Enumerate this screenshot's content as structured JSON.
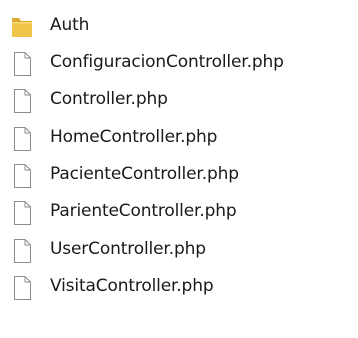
{
  "folder": {
    "items": [
      {
        "name": "Auth",
        "type": "folder",
        "icon": "folder-icon"
      },
      {
        "name": "ConfiguracionController.php",
        "type": "file",
        "icon": "file-icon"
      },
      {
        "name": "Controller.php",
        "type": "file",
        "icon": "file-icon"
      },
      {
        "name": "HomeController.php",
        "type": "file",
        "icon": "file-icon"
      },
      {
        "name": "PacienteController.php",
        "type": "file",
        "icon": "file-icon"
      },
      {
        "name": "ParienteController.php",
        "type": "file",
        "icon": "file-icon"
      },
      {
        "name": "UserController.php",
        "type": "file",
        "icon": "file-icon"
      },
      {
        "name": "VisitaController.php",
        "type": "file",
        "icon": "file-icon"
      }
    ]
  },
  "colors": {
    "folder_body": "#F0C64A",
    "folder_tab": "#DDA92F",
    "file_outline": "#8C8C8C",
    "file_fill": "#FFFFFF",
    "text": "#1A1A1A"
  }
}
